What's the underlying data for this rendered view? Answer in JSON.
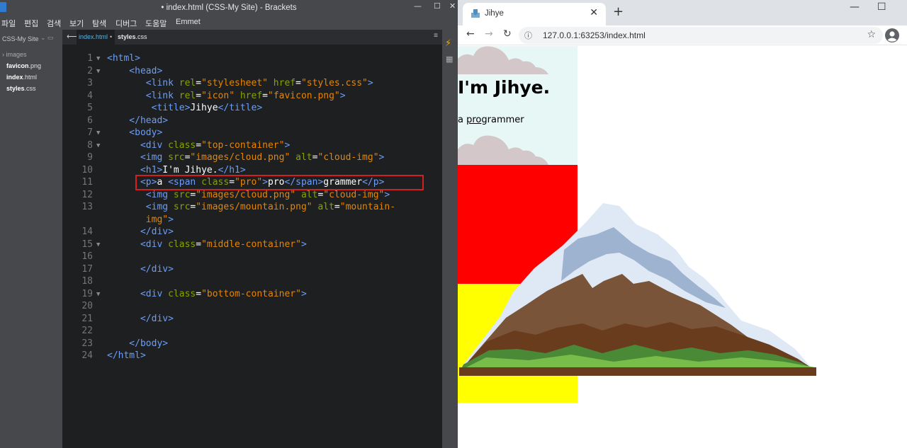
{
  "brackets": {
    "window_title": "• index.html (CSS-My Site) - Brackets",
    "window_controls": [
      "—",
      "☐",
      "✕"
    ],
    "menu": [
      "파일",
      "편집",
      "검색",
      "보기",
      "탐색",
      "디버그",
      "도움말",
      "Emmet"
    ],
    "sidebar": {
      "project": "CSS-My Site",
      "folder": "› images",
      "files": [
        {
          "name": "favicon",
          "ext": ".png"
        },
        {
          "name": "index",
          "ext": ".html"
        },
        {
          "name": "styles",
          "ext": ".css"
        }
      ]
    },
    "tabs": {
      "active": "index.html",
      "active_dirty_dot": "•",
      "second_name": "styles",
      "second_ext": ".css"
    },
    "code": {
      "line_numbers": [
        "1",
        "2",
        "3",
        "4",
        "5",
        "6",
        "7",
        "8",
        "9",
        "10",
        "11",
        "12",
        "13",
        "",
        "14",
        "15",
        "16",
        "17",
        "18",
        "19",
        "20",
        "21",
        "22",
        "23",
        "24"
      ],
      "fold_markers": [
        "▼",
        "▼",
        "",
        "",
        "",
        "",
        "▼",
        "▼",
        "",
        "",
        "",
        "",
        "",
        "",
        "",
        "▼",
        "",
        "",
        "",
        "▼",
        "",
        "",
        "",
        "",
        ""
      ]
    }
  },
  "chrome": {
    "tab_title": "Jihye",
    "new_tab": "+",
    "url": "127.0.0.1:63253/index.html",
    "window_controls": [
      "—",
      "☐"
    ],
    "page": {
      "h1": "I'm Jihye.",
      "p_before": "a ",
      "p_pro": "pro",
      "p_after": "grammer"
    }
  }
}
